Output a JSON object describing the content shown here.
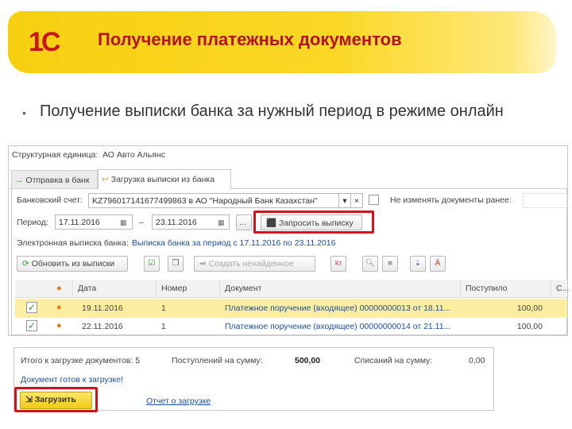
{
  "header": {
    "logo": "1С",
    "title": "Получение платежных документов"
  },
  "bullet": "Получение выписки банка за нужный период в режиме онлайн",
  "form": {
    "structure_label": "Структурная единица:",
    "structure_value": "АО Авто Альянс",
    "tabs": [
      {
        "label": "Отправка в банк"
      },
      {
        "label": "Загрузка выписки из банка"
      }
    ],
    "account_label": "Банковский счет:",
    "account_value": "KZ796017141677499863 в АО \"Народный Банк Казахстан\"",
    "no_change_label": "Не изменять документы ранее:",
    "period_label": "Период:",
    "date_from": "17.11.2016",
    "date_to": "23.11.2016",
    "dash": "–",
    "ellipsis": "...",
    "request_button": "Запросить выписку",
    "estatement_label": "Электронная выписка банка:",
    "estatement_link": "Выписка банка за период с 17.11.2016 по 23.11.2016",
    "refresh_button": "Обновить из выписки",
    "create_button": "Создать ненайденное"
  },
  "table": {
    "columns": [
      "Дата",
      "Номер",
      "Документ",
      "Поступило",
      "С..."
    ],
    "rows": [
      {
        "date": "19.11.2016",
        "number": "1",
        "document": "Платежное поручение (входящее) 00000000013 от 18.11...",
        "amount": "100,00"
      },
      {
        "date": "22.11.2016",
        "number": "1",
        "document": "Платежное поручение (входящее) 00000000014 от 21.11...",
        "amount": "100,00"
      }
    ]
  },
  "footer": {
    "total_label": "Итого к загрузке документов: 5",
    "income_label": "Поступлений на сумму:",
    "income_value": "500,00",
    "outcome_label": "Списаний на сумму:",
    "outcome_value": "0,00",
    "ready_text": "Документ готов к загрузке!",
    "load_button": "Загрузить",
    "report_link": "Отчет о загрузке"
  },
  "colors": {
    "accent": "#f7cf10",
    "title": "#b3141a",
    "highlight": "#d0121a",
    "row_selected": "#fbeea0"
  }
}
